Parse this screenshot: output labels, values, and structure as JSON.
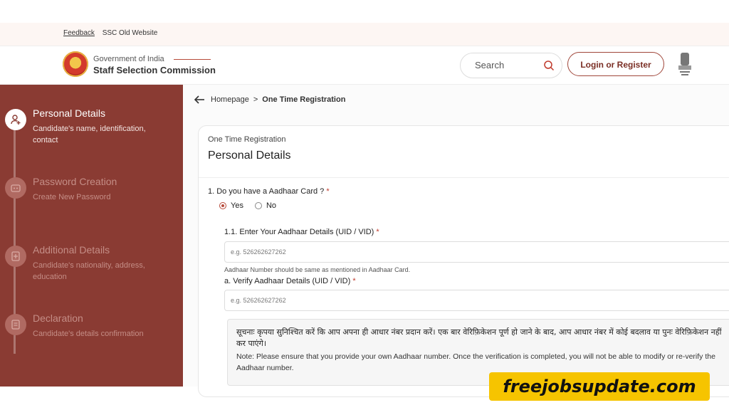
{
  "topbar": {
    "feedback": "Feedback",
    "old_site": "SSC Old Website"
  },
  "header": {
    "org_top": "Government of India",
    "org_main": "Staff Selection Commission",
    "search_placeholder": "Search",
    "login_label": "Login or Register"
  },
  "sidebar": {
    "steps": [
      {
        "title": "Personal Details",
        "desc": "Candidate's name, identification, contact",
        "state": "active"
      },
      {
        "title": "Password Creation",
        "desc": "Create New Password",
        "state": "inactive"
      },
      {
        "title": "Additional Details",
        "desc": "Candidate's nationality, address, education",
        "state": "inactive"
      },
      {
        "title": "Declaration",
        "desc": "Candidate's details confirmation",
        "state": "inactive"
      }
    ]
  },
  "breadcrumb": {
    "home": "Homepage",
    "sep": ">",
    "current": "One Time Registration"
  },
  "form": {
    "kicker": "One Time Registration",
    "title": "Personal Details",
    "q1_label": "1. Do you have a Aadhaar Card ?",
    "required_mark": "*",
    "yes": "Yes",
    "no": "No",
    "selected": "Yes",
    "q11_label": "1.1. Enter Your Aadhaar Details (UID / VID)",
    "uid_placeholder": "e.g. 526262627262",
    "hint": "Aadhaar Number should be same as mentioned in Aadhaar Card.",
    "verify_label": "a. Verify Aadhaar Details (UID / VID)",
    "verify_placeholder": "e.g. 526262627262",
    "notice_hi": "सूचनाः कृपया सुनिश्चित करें कि आप अपना ही आधार नंबर प्रदान करें। एक बार वेरिफ़िकेशन पूर्ण हो जाने के बाद, आप आधार नंबर में कोई बदलाव या पुनः वेरिफ़िकेशन नहीं कर पाएंगे।",
    "notice_en": "Note: Please ensure that you provide your own Aadhaar number. Once the verification is completed, you will not be able to modify or re-verify the Aadhaar number."
  },
  "watermark": "freejobsupdate.com",
  "colors": {
    "sidebar": "#8a3b33",
    "accent": "#b74a3a",
    "badge": "#f6c400"
  }
}
